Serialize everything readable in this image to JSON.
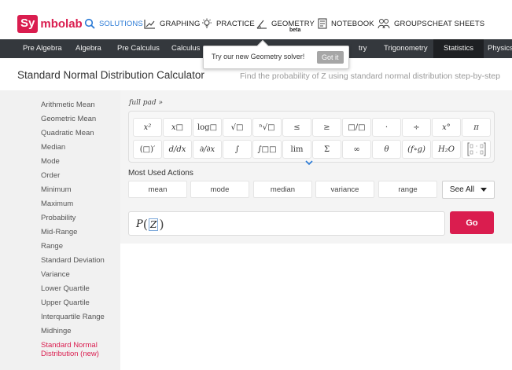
{
  "brand": {
    "logo_prefix": "Sy",
    "logo_rest": "mbolab"
  },
  "topnav": [
    {
      "label": "SOLUTIONS",
      "icon": "search-icon",
      "active": true
    },
    {
      "label": "GRAPHING",
      "icon": "graph-icon"
    },
    {
      "label": "PRACTICE",
      "icon": "lightbulb-icon"
    },
    {
      "label": "GEOMETRY",
      "icon": "geometry-icon",
      "badge": "beta"
    },
    {
      "label": "NOTEBOOK",
      "icon": "notebook-icon"
    },
    {
      "label": "GROUPS",
      "icon": "groups-icon"
    },
    {
      "label": "CHEAT SHEETS"
    }
  ],
  "categories": [
    "Pre Algebra",
    "Algebra",
    "Pre Calculus",
    "Calculus",
    "try",
    "Trigonometry",
    "Statistics",
    "Physics"
  ],
  "active_category": "Statistics",
  "tooltip": {
    "text": "Try our new Geometry solver!",
    "button": "Got it"
  },
  "page": {
    "title": "Standard Normal Distribution Calculator",
    "subtitle": "Find the probability of Z using standard normal distribution step-by-step"
  },
  "sidebar": {
    "items": [
      "Arithmetic Mean",
      "Geometric Mean",
      "Quadratic Mean",
      "Median",
      "Mode",
      "Order",
      "Minimum",
      "Maximum",
      "Probability",
      "Mid-Range",
      "Range",
      "Standard Deviation",
      "Variance",
      "Lower Quartile",
      "Upper Quartile",
      "Interquartile Range",
      "Midhinge"
    ],
    "active_item": "Standard Normal Distribution (new)"
  },
  "keypad": {
    "full_pad_label": "full pad »",
    "row1": [
      "x²",
      "x□",
      "log□",
      "√□",
      "ⁿ√□",
      "≤",
      "≥",
      "□/□",
      "·",
      "÷",
      "x°",
      "π"
    ],
    "row2": [
      "(□)′",
      "d/dx",
      "∂/∂x",
      "∫",
      "∫□□",
      "lim",
      "Σ",
      "∞",
      "θ",
      "(f∘g)",
      "H₂O",
      "matrix"
    ]
  },
  "most_used": {
    "label": "Most Used Actions",
    "actions": [
      "mean",
      "mode",
      "median",
      "variance",
      "range"
    ],
    "see_all": "See All"
  },
  "input": {
    "prefix": "P",
    "variable": "Z"
  },
  "go_label": "Go",
  "colors": {
    "brand": "#da1d4f",
    "catbar": "#34383d",
    "active_nav": "#2a7ad6"
  }
}
